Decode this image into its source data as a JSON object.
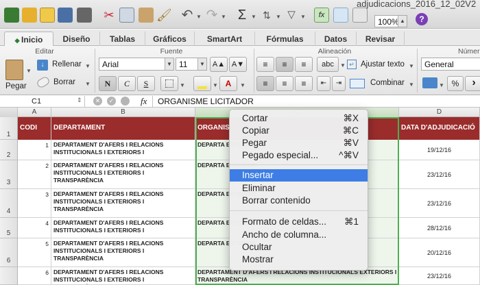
{
  "window": {
    "title": "adjudicacions_2016_12_02V2"
  },
  "toolbar": {
    "zoom": "100%"
  },
  "ribbon": {
    "tabs": [
      "Inicio",
      "Diseño",
      "Tablas",
      "Gráficos",
      "SmartArt",
      "Fórmulas",
      "Datos",
      "Revisar"
    ],
    "active_tab": "Inicio",
    "groups": {
      "editar": "Editar",
      "fuente": "Fuente",
      "alineacion": "Alineación",
      "numero": "Númer"
    },
    "edit": {
      "paste": "Pegar",
      "fill": "Rellenar",
      "clear": "Borrar"
    },
    "font": {
      "name": "Arial",
      "size": "11",
      "bold": "N",
      "italic": "C",
      "underline": "S"
    },
    "align": {
      "text_type": "abc",
      "wrap": "Ajustar texto",
      "merge": "Combinar"
    },
    "number": {
      "format": "General",
      "percent": "%"
    }
  },
  "formula_bar": {
    "cell_ref": "C1",
    "fx": "fx",
    "content": "ORGANISME LICITADOR"
  },
  "grid": {
    "columns": [
      "A",
      "B",
      "C",
      "D"
    ],
    "rows": [
      "1",
      "2",
      "3",
      "4",
      "5",
      "6"
    ],
    "headers": {
      "codi": "CODI",
      "departament": "DEPARTAMENT",
      "organisme": "ORGANIS",
      "data": "DATA D'ADJUDICACIÓ"
    },
    "data_rows": [
      {
        "codi": "1",
        "departament": "DEPARTAMENT D'AFERS I RELACIONS INSTITUCIONALS I EXTERIORS I",
        "organisme": "DEPARTA EXTERIOR",
        "data": "19/12/16"
      },
      {
        "codi": "2",
        "departament": "DEPARTAMENT D'AFERS I RELACIONS INSTITUCIONALS I EXTERIORS I TRANSPARÈNCIA",
        "organisme": "DEPARTA EXTERIOR",
        "data": "23/12/16"
      },
      {
        "codi": "3",
        "departament": "DEPARTAMENT D'AFERS I RELACIONS INSTITUCIONALS I EXTERIORS I TRANSPARÈNCIA",
        "organisme": "DEPARTA EXTERIOR",
        "data": "23/12/16"
      },
      {
        "codi": "4",
        "departament": "DEPARTAMENT D'AFERS I RELACIONS INSTITUCIONALS I EXTERIORS I",
        "organisme": "DEPARTA EXTERIOR",
        "data": "28/12/16"
      },
      {
        "codi": "5",
        "departament": "DEPARTAMENT D'AFERS I RELACIONS INSTITUCIONALS I EXTERIORS I TRANSPARÈNCIA",
        "organisme": "DEPARTA EXTERIOR",
        "data": "20/12/16"
      },
      {
        "codi": "6",
        "departament": "DEPARTAMENT D'AFERS I RELACIONS INSTITUCIONALS I EXTERIORS I TRANSPARÈNCIA",
        "organisme": "DEPARTAMENT D'AFERS I RELACIONS INSTITUCIONALS EXTERIORS I TRANSPARÈNCIA",
        "data": "23/12/16"
      }
    ]
  },
  "context_menu": {
    "items": [
      {
        "label": "Cortar",
        "shortcut": "⌘X"
      },
      {
        "label": "Copiar",
        "shortcut": "⌘C"
      },
      {
        "label": "Pegar",
        "shortcut": "⌘V"
      },
      {
        "label": "Pegado especial...",
        "shortcut": "^⌘V"
      },
      {
        "label": "Insertar",
        "shortcut": ""
      },
      {
        "label": "Eliminar",
        "shortcut": ""
      },
      {
        "label": "Borrar contenido",
        "shortcut": ""
      },
      {
        "label": "Formato de celdas...",
        "shortcut": "⌘1"
      },
      {
        "label": "Ancho de columna...",
        "shortcut": ""
      },
      {
        "label": "Ocultar",
        "shortcut": ""
      },
      {
        "label": "Mostrar",
        "shortcut": ""
      }
    ],
    "highlighted": "Insertar"
  },
  "colors": {
    "header_fill": "#9b2c2c",
    "selection": "#4caf50",
    "menu_highlight": "#3d7de5"
  }
}
